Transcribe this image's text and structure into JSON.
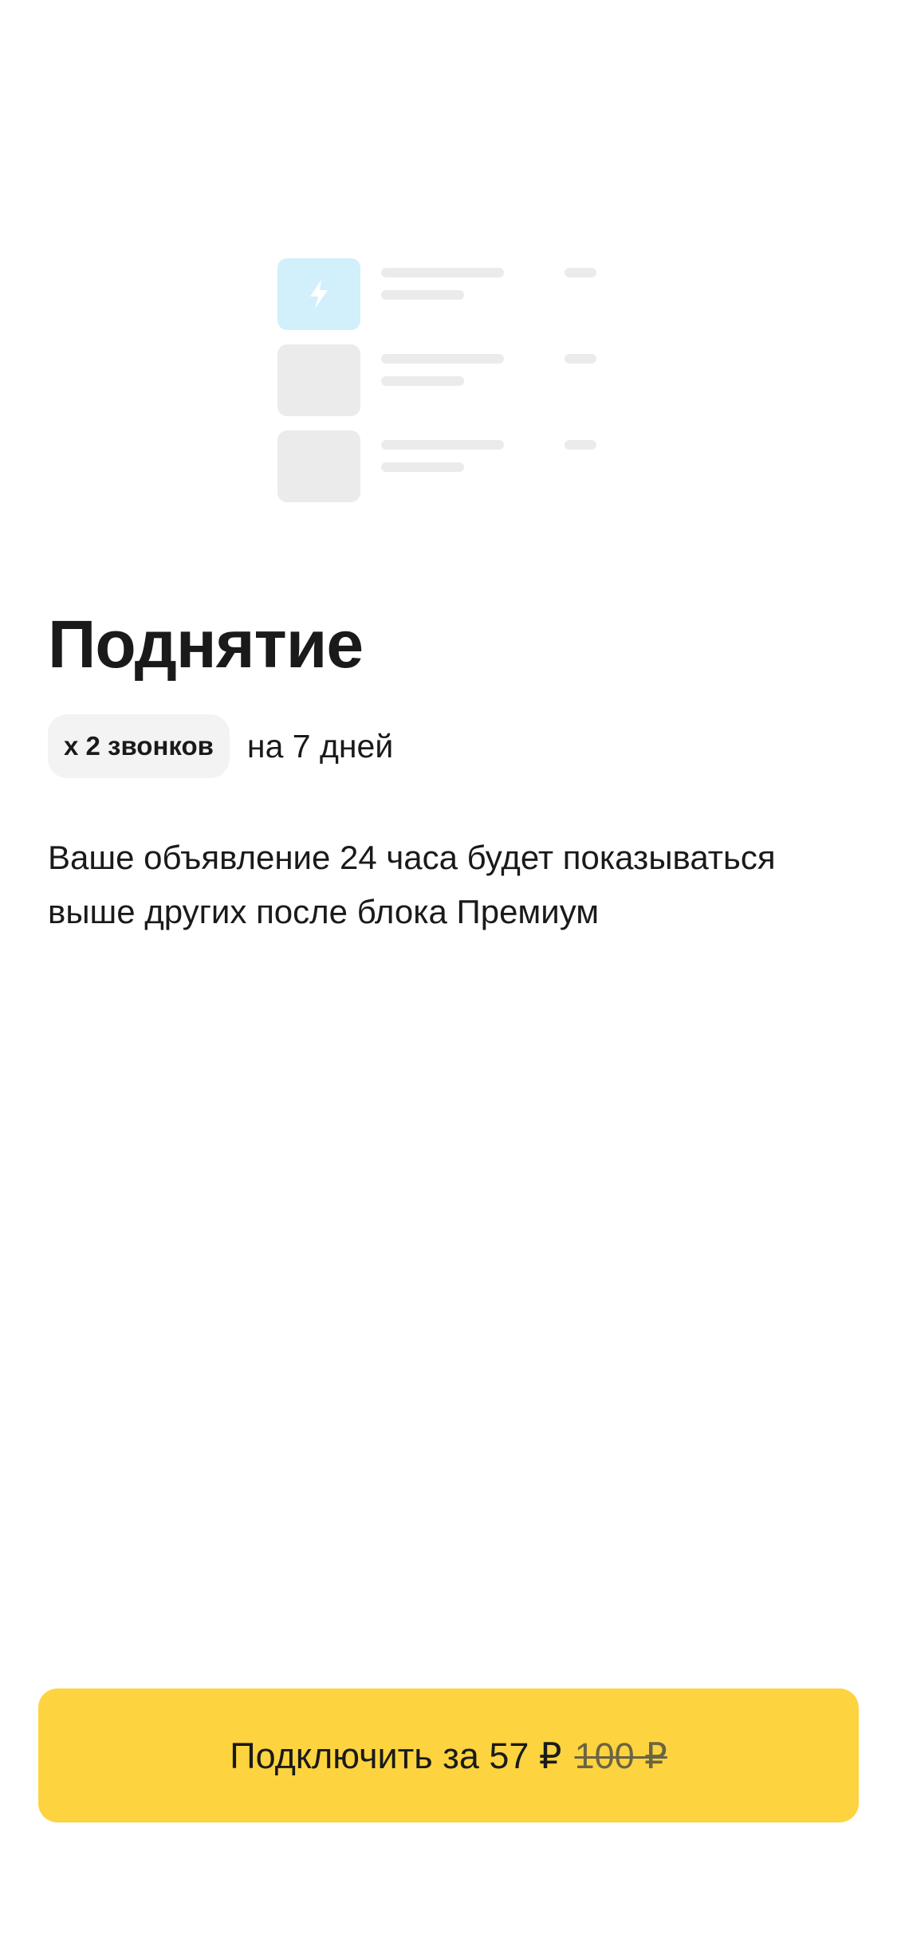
{
  "illustration": {
    "rows": [
      {
        "highlighted": true,
        "icon": "lightning-icon"
      },
      {
        "highlighted": false
      },
      {
        "highlighted": false
      }
    ],
    "accent_color": "#d2effc"
  },
  "title": "Поднятие",
  "chip": {
    "label": "x 2 звонков"
  },
  "duration": "на 7 дней",
  "description": "Ваше объявление 24 часа будет показываться выше других после блока Премиум",
  "cta": {
    "label": "Подключить за 57 ₽",
    "old_price": "100 ₽",
    "color": "#fdd43f"
  }
}
